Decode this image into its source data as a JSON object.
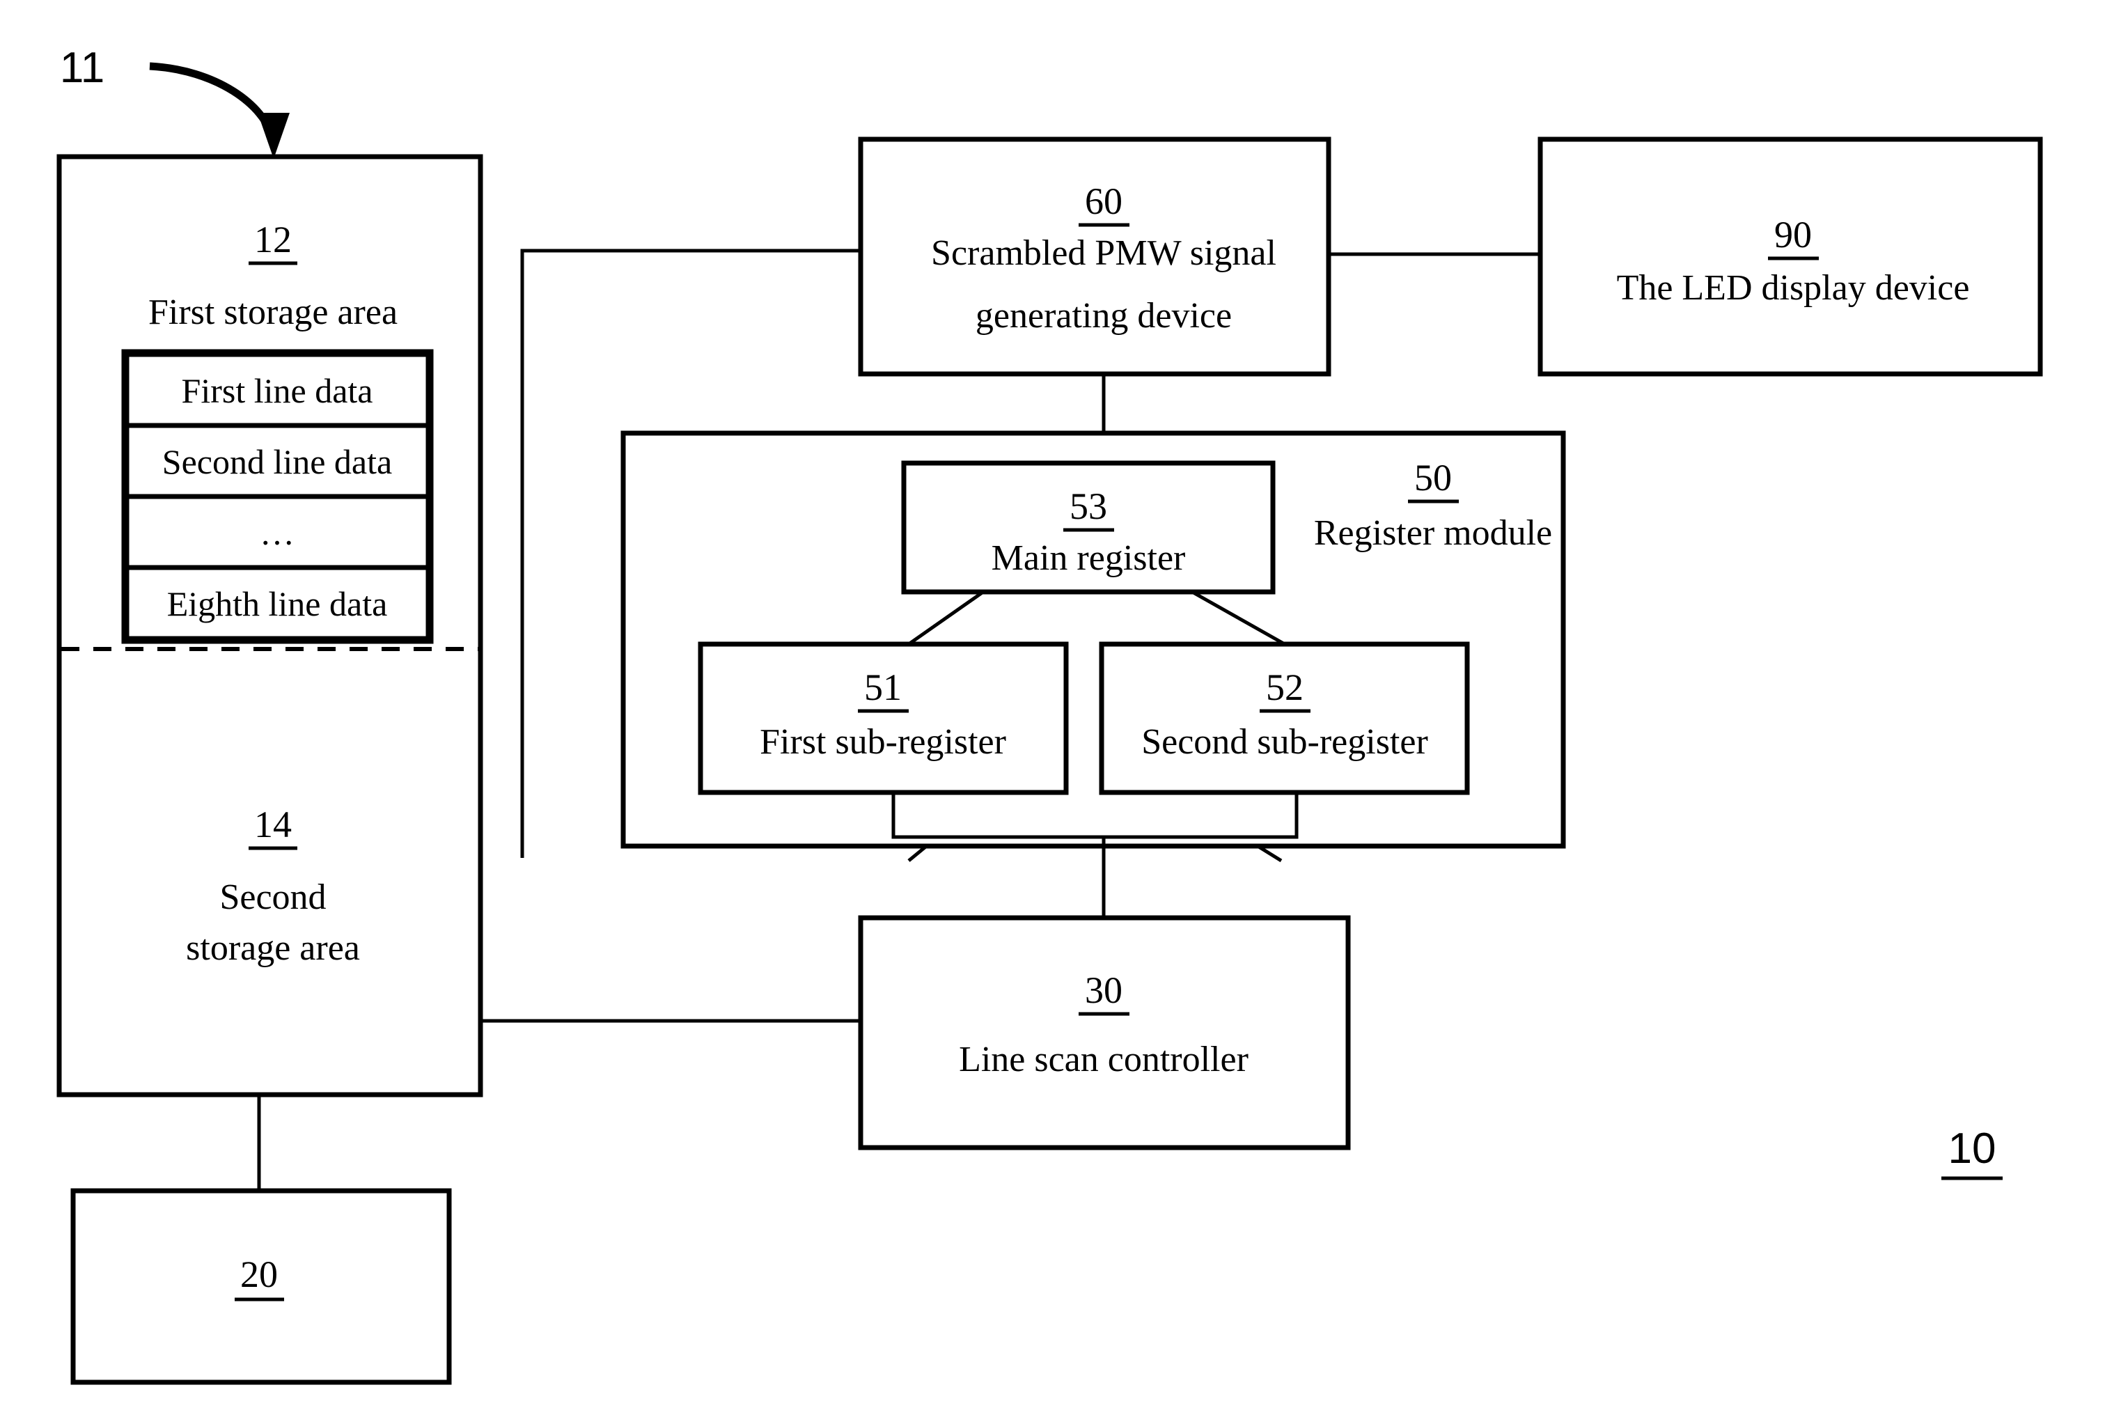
{
  "figure": {
    "system_ref": "10",
    "storage_ref": "11"
  },
  "blocks": {
    "storage_device": {
      "ref": "11",
      "first_area": {
        "ref": "12",
        "label": "First storage area",
        "line_rows": [
          "First line data",
          "Second line data",
          "…",
          "Eighth line data"
        ]
      },
      "second_area": {
        "ref": "14",
        "label_line1": "Second",
        "label_line2": "storage area"
      }
    },
    "block20": {
      "ref": "20",
      "label": ""
    },
    "pwm_generator": {
      "ref": "60",
      "label_line1": "Scrambled PMW signal",
      "label_line2": "generating device"
    },
    "led_display": {
      "ref": "90",
      "label": "The LED display device"
    },
    "register_module": {
      "ref": "50",
      "label": "Register module",
      "main_register": {
        "ref": "53",
        "label": "Main register"
      },
      "first_sub_register": {
        "ref": "51",
        "label": "First sub-register"
      },
      "second_sub_register": {
        "ref": "52",
        "label": "Second sub-register"
      }
    },
    "line_scan_controller": {
      "ref": "30",
      "label": "Line scan controller"
    }
  }
}
